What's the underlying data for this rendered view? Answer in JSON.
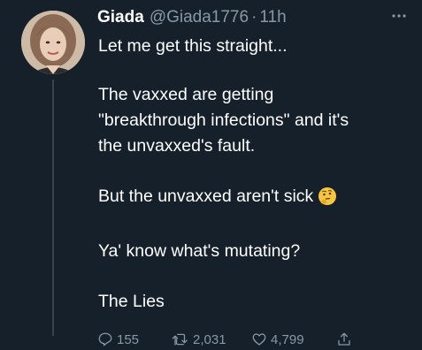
{
  "tweet": {
    "author": {
      "name": "Giada",
      "handle": "@Giada1776",
      "separator": "·",
      "time": "11h"
    },
    "paragraphs": [
      "Let me get this straight...",
      "The vaxxed are getting\n\"breakthrough infections\" and it's\nthe unvaxxed's fault.",
      "But the unvaxxed aren't sick",
      "Ya' know what's mutating?",
      "The Lies"
    ],
    "emoji_icon": "thinking-face-emoji",
    "actions": {
      "replies": "155",
      "retweets": "2,031",
      "likes": "4,799"
    },
    "icons": {
      "more": "more-options-icon",
      "reply": "reply-icon",
      "retweet": "retweet-icon",
      "like": "heart-icon",
      "share": "share-icon"
    },
    "colors": {
      "background": "#15202b",
      "text": "#ffffff",
      "secondary": "#8899a6",
      "thread_line": "#38444d"
    }
  }
}
